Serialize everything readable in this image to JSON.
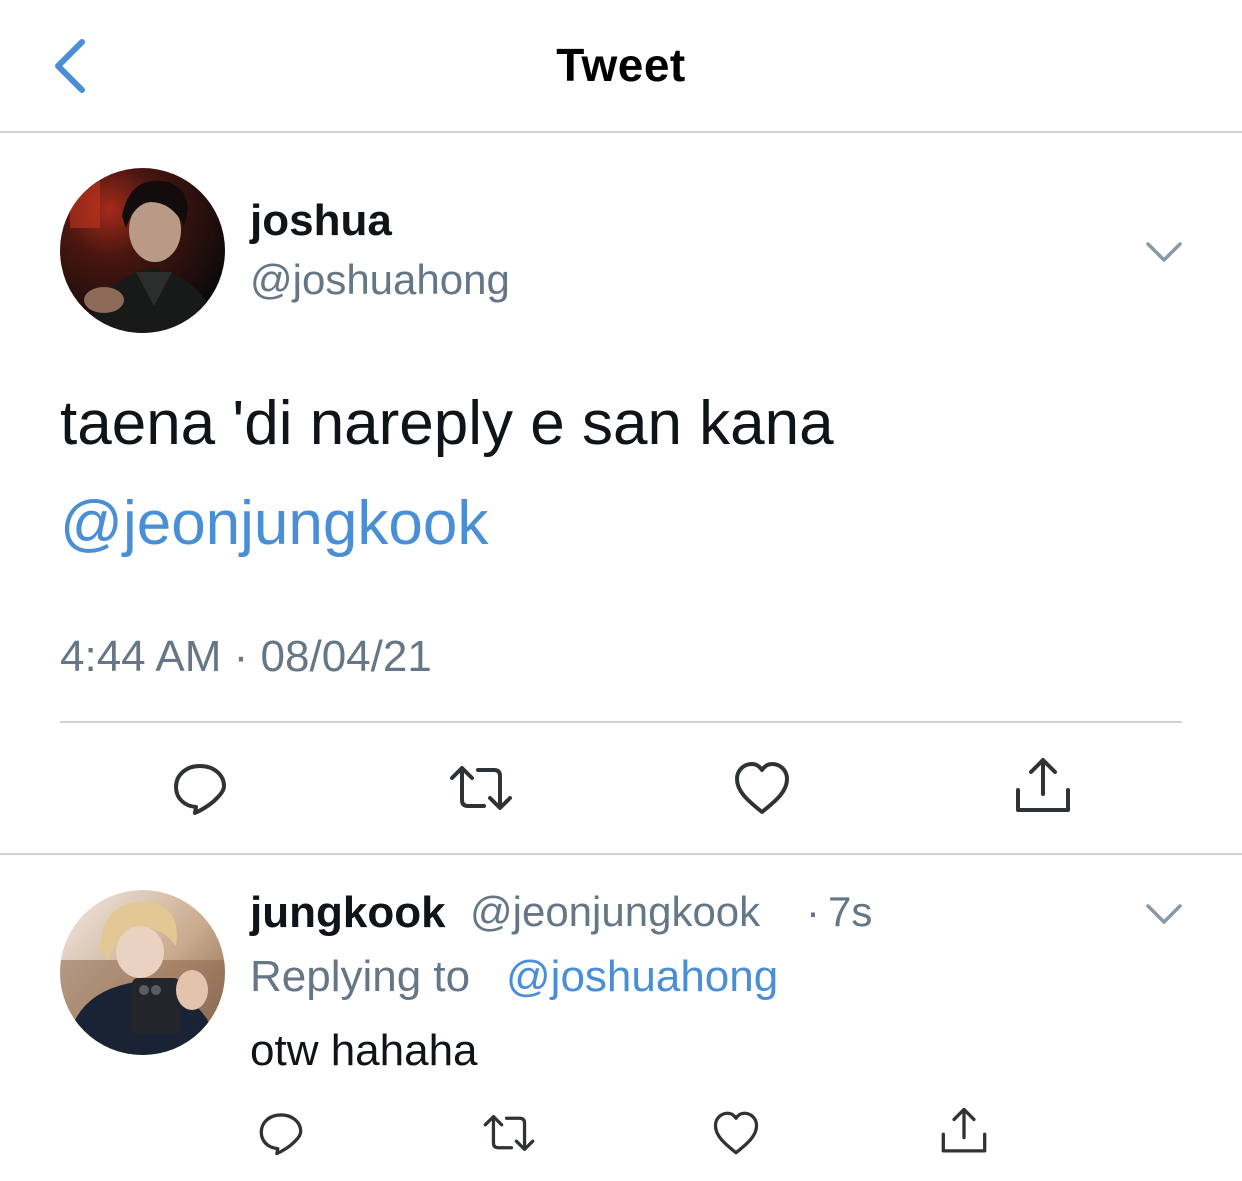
{
  "header": {
    "title": "Tweet",
    "back_icon": "chevron-left-icon"
  },
  "colors": {
    "accent": "#4a8fd6",
    "text": "#0f1419",
    "secondary": "#657786",
    "divider": "#cfd3d8"
  },
  "main_tweet": {
    "display_name": "joshua",
    "handle": "@joshuahong",
    "text": "taena 'di nareply e san kana",
    "mention": "@jeonjungkook",
    "timestamp": "4:44 AM · 08/04/21",
    "actions": [
      "reply-icon",
      "retweet-icon",
      "like-icon",
      "share-icon"
    ]
  },
  "reply_tweet": {
    "display_name": "jungkook",
    "handle": "@jeonjungkook",
    "separator": "·",
    "time": "7s",
    "replying_prefix": "Replying to",
    "replying_to": "@joshuahong",
    "text": "otw hahaha",
    "actions": [
      "reply-icon",
      "retweet-icon",
      "like-icon",
      "share-icon"
    ]
  }
}
